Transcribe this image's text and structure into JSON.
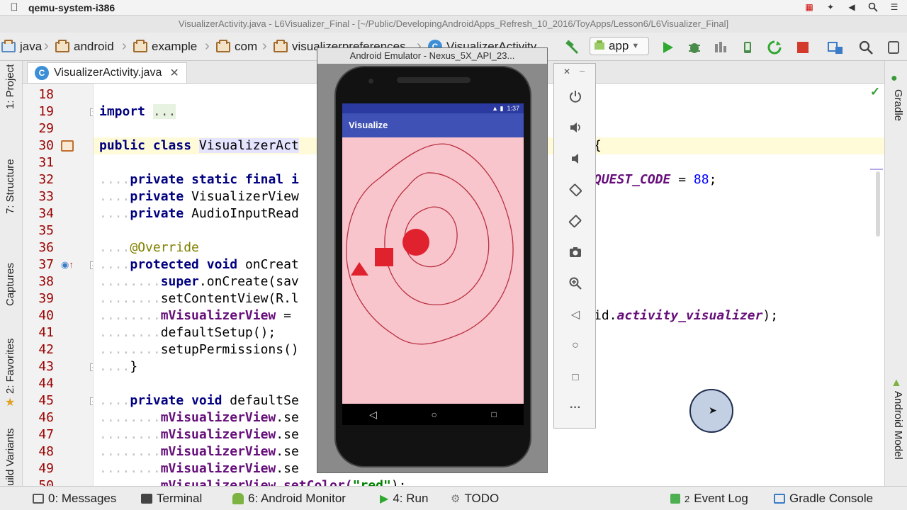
{
  "menubar": {
    "app_name": "qemu-system-i386"
  },
  "window": {
    "title": "VisualizerActivity.java - L6Visualizer_Final - [~/Public/DevelopingAndroidApps_Refresh_10_2016/ToyApps/Lesson6/L6Visualizer_Final]"
  },
  "breadcrumbs": [
    "java",
    "android",
    "example",
    "com",
    "visualizerpreferences",
    "VisualizerActivity"
  ],
  "toolbar": {
    "run_config": "app"
  },
  "editor_tab": {
    "label": "VisualizerActivity.java",
    "icon_letter": "C"
  },
  "left_tool_tabs": [
    "1: Project",
    "7: Structure",
    "Captures",
    "2: Favorites",
    "Build Variants"
  ],
  "right_tool_tabs": [
    "Gradle",
    "Android Model"
  ],
  "code": {
    "line_numbers": [
      "18",
      "19",
      "29",
      "30",
      "31",
      "32",
      "33",
      "34",
      "35",
      "36",
      "37",
      "38",
      "39",
      "40",
      "41",
      "42",
      "43",
      "44",
      "45",
      "46",
      "47",
      "48",
      "49",
      "50"
    ],
    "import_kw": "import",
    "import_fold": "...",
    "public_kw": "public",
    "class_kw": "class",
    "class_name": "VisualizerAct",
    "line30_tail": "{",
    "private_kw": "private",
    "static_kw": "static",
    "final_kw": "final",
    "line32_partial": "i",
    "line32_field": "QUEST_CODE",
    "line32_value": "88",
    "line33_type": "VisualizerView",
    "line34_type": "AudioInputRead",
    "override_annotation": "@Override",
    "protected_kw": "protected",
    "void_kw": "void",
    "line37_method": "onCreat",
    "super_kw": "super",
    "line38_call": ".onCreate(sav",
    "line39_text": "setContentView(R.l",
    "visualizer_field": "mVisualizerView",
    "line40_mid": " = ",
    "line40_tail_prefix": "id.",
    "line40_layout": "activity_visualizer",
    "line40_end": ");",
    "line41_text": "defaultSetup();",
    "line42_text": "setupPermissions()",
    "line43_text": "}",
    "line45_method": "defaultSe",
    "line46_tail": ".se",
    "line49_tail": ".se",
    "line50_text": "mVisualizerView.setColor(",
    "line50_string": "\"red\"",
    "line50_end": ");"
  },
  "emulator": {
    "title": "Android Emulator - Nexus_5X_API_23...",
    "status_time": "1:37",
    "app_title": "Visualize",
    "screen_color": "#f8c5cc",
    "shape_color": "#e0222f"
  },
  "bottom_tools": {
    "messages": "0: Messages",
    "terminal": "Terminal",
    "android_monitor": "6: Android Monitor",
    "run": "4: Run",
    "todo": "TODO",
    "event_log_count": "2",
    "event_log": "Event Log",
    "gradle_console": "Gradle Console"
  }
}
